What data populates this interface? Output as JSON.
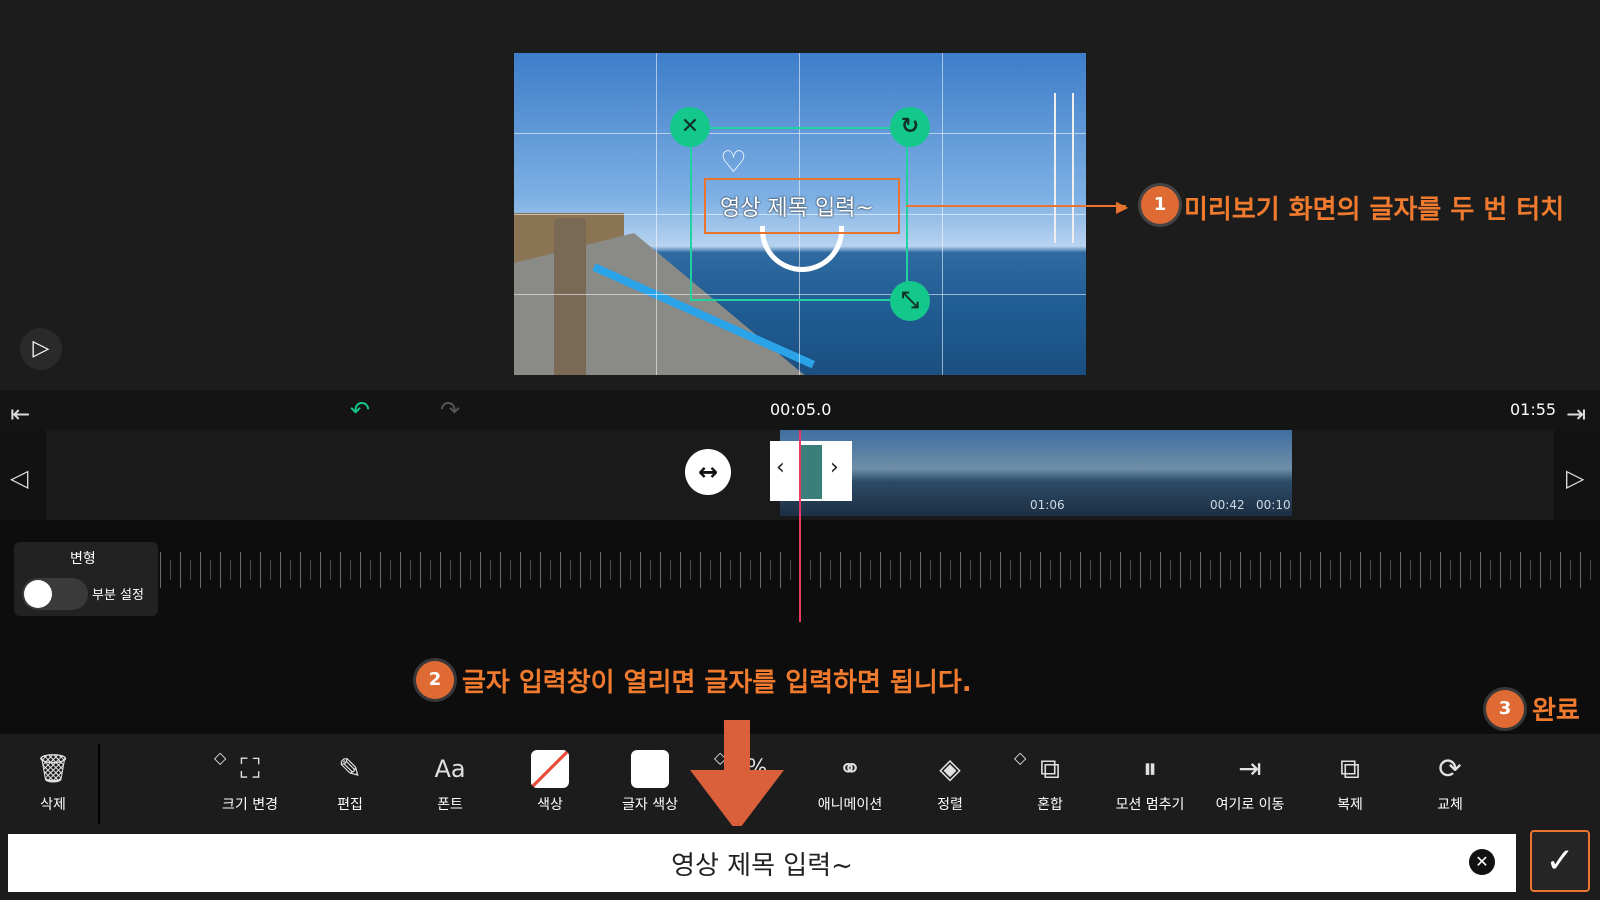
{
  "preview": {
    "overlay_text": "영상 제목 입력~",
    "play_icon": "▷"
  },
  "annotations": {
    "step1_number": "1",
    "step1_text": "미리보기 화면의 글자를 두 번 터치",
    "step2_number": "2",
    "step2_text": "글자 입력창이 열리면 글자를 입력하면 됩니다.",
    "step3_number": "3",
    "step3_text": "완료"
  },
  "timeline": {
    "current_time": "00:05.0",
    "total_time": "01:55",
    "clip_times": [
      "01:06",
      "00:42",
      "00:10"
    ]
  },
  "transform_panel": {
    "title": "변형",
    "toggle_label": "부분 설정",
    "toggle_on": false
  },
  "toolbar": {
    "items": [
      {
        "label": "삭제",
        "icon": "trash-icon"
      },
      {
        "label": "크기 변경",
        "icon": "crop-icon"
      },
      {
        "label": "편집",
        "icon": "pencil-icon"
      },
      {
        "label": "폰트",
        "icon": "font-icon"
      },
      {
        "label": "색상",
        "icon": "no-color-swatch"
      },
      {
        "label": "글자 색상",
        "icon": "white-swatch"
      },
      {
        "label": "0%",
        "icon": "opacity-icon"
      },
      {
        "label": "애니메이션",
        "icon": "animation-icon"
      },
      {
        "label": "정렬",
        "icon": "layers-icon"
      },
      {
        "label": "혼합",
        "icon": "blend-icon"
      },
      {
        "label": "모션 멈추기",
        "icon": "pause-icon"
      },
      {
        "label": "여기로 이동",
        "icon": "move-here-icon"
      },
      {
        "label": "복제",
        "icon": "duplicate-icon"
      },
      {
        "label": "교체",
        "icon": "replace-icon"
      }
    ]
  },
  "input": {
    "value": "영상 제목 입력~"
  },
  "colors": {
    "accent_orange": "#e8742f",
    "handle_green": "#14c78b",
    "playhead": "#e83a62"
  }
}
